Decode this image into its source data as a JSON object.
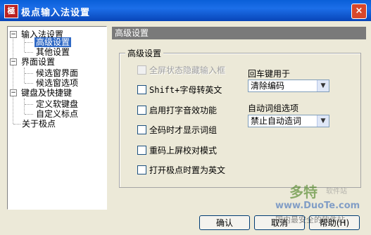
{
  "window": {
    "title": "极点输入法设置",
    "icon_text": "極",
    "close_label": "×"
  },
  "tree": {
    "nodes": [
      {
        "label": "输入法设置",
        "expand": "−"
      },
      {
        "label": "高级设置",
        "selected": true
      },
      {
        "label": "其他设置"
      },
      {
        "label": "界面设置",
        "expand": "−"
      },
      {
        "label": "候选窗界面"
      },
      {
        "label": "候选窗选项"
      },
      {
        "label": "键盘及快捷键",
        "expand": "−"
      },
      {
        "label": "定义软键盘"
      },
      {
        "label": "自定义标点"
      },
      {
        "label": "关于极点"
      }
    ]
  },
  "panel": {
    "header": "高级设置",
    "group_label": "高级设置",
    "checkboxes": [
      {
        "label": "全屏状态隐藏输入框",
        "checked": false,
        "disabled": true
      },
      {
        "label": "Shift+字母转英文",
        "checked": false,
        "disabled": false
      },
      {
        "label": "启用打字音效功能",
        "checked": false,
        "disabled": false
      },
      {
        "label": "全码时才显示词组",
        "checked": false,
        "disabled": false
      },
      {
        "label": "重码上屏校对模式",
        "checked": false,
        "disabled": false
      },
      {
        "label": "打开极点时置为英文",
        "checked": false,
        "disabled": false
      }
    ],
    "enter_label": "回车键用于",
    "enter_value": "清除编码",
    "phrase_label": "自动词组选项",
    "phrase_value": "禁止自动造词"
  },
  "buttons": {
    "ok": "确认",
    "cancel": "取消",
    "help": "帮助(H)"
  },
  "watermark": {
    "brand": "多特",
    "sub": "软件站",
    "site": "www.DuoTe.com",
    "slogan": "国内最安全的软件站"
  }
}
